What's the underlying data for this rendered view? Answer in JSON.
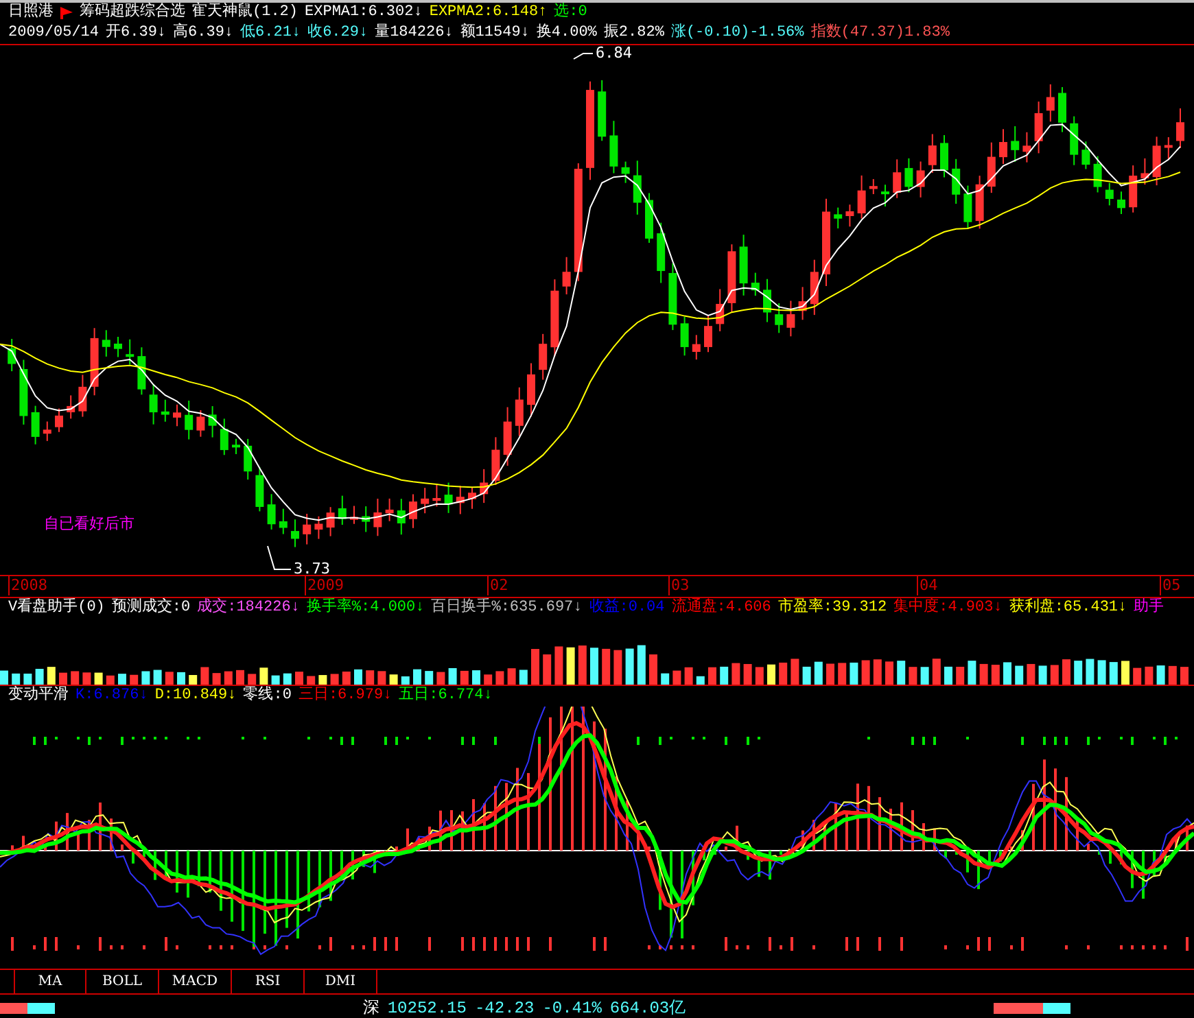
{
  "title_row": {
    "stock": "日照港",
    "formula": "筹码超跌综合选",
    "indicator": "寉天神鼠(1.2)",
    "values": [
      {
        "text": "EXPMA1:6.302↓",
        "color": "#ffffff"
      },
      {
        "text": "EXPMA2:6.148↑",
        "color": "#ffff00"
      },
      {
        "text": "选:0",
        "color": "#00ff00"
      }
    ]
  },
  "quote_row": [
    {
      "text": "2009/05/14",
      "color": "#ffffff"
    },
    {
      "text": "开6.39↓",
      "color": "#ffffff"
    },
    {
      "text": "高6.39↓",
      "color": "#ffffff"
    },
    {
      "text": "低6.21↓",
      "color": "#54fcfc"
    },
    {
      "text": "收6.29↓",
      "color": "#54fcfc"
    },
    {
      "text": "量184226↓",
      "color": "#ffffff"
    },
    {
      "text": "额11549↓",
      "color": "#ffffff"
    },
    {
      "text": "换4.00%",
      "color": "#ffffff"
    },
    {
      "text": "振2.82%",
      "color": "#ffffff"
    },
    {
      "text": "涨(-0.10)-1.56%",
      "color": "#54fcfc"
    },
    {
      "text": "指数(47.37)1.83%",
      "color": "#ff5454"
    }
  ],
  "price_chart": {
    "high_label": "6.84",
    "low_label": "3.73",
    "note": "自已看好后市"
  },
  "date_axis": [
    "2008",
    "2009",
    "02",
    "03",
    "04",
    "05"
  ],
  "volume_row": [
    {
      "text": "V看盘助手(0)",
      "color": "#ffffff"
    },
    {
      "text": "预测成交:0",
      "color": "#ffffff"
    },
    {
      "text": "成交:184226↓",
      "color": "#ff54ff"
    },
    {
      "text": "换手率%:4.000↓",
      "color": "#00ff00"
    },
    {
      "text": "百日换手%:635.697↓",
      "color": "#c0c0c0"
    },
    {
      "text": "收益:0.04",
      "color": "#0000ff"
    },
    {
      "text": "流通盘:4.606",
      "color": "#ff0000"
    },
    {
      "text": "市盈率:39.312",
      "color": "#ffff00"
    },
    {
      "text": "集中度:4.903↓",
      "color": "#ff0000"
    },
    {
      "text": "获利盘:65.431↓",
      "color": "#ffff00"
    },
    {
      "text": "助手",
      "color": "#ff00ff"
    }
  ],
  "indicator_row": [
    {
      "text": "变动平滑",
      "color": "#ffffff"
    },
    {
      "text": "K:6.876↓",
      "color": "#0000ff"
    },
    {
      "text": "D:10.849↓",
      "color": "#ffff00"
    },
    {
      "text": "零线:0",
      "color": "#ffffff"
    },
    {
      "text": "三日:6.979↓",
      "color": "#ff0000"
    },
    {
      "text": "五日:6.774↓",
      "color": "#00ff00"
    }
  ],
  "tabs": [
    {
      "label": "MA",
      "selected": false
    },
    {
      "label": "BOLL",
      "selected": false
    },
    {
      "label": "MACD",
      "selected": false
    },
    {
      "label": "RSI",
      "selected": false
    },
    {
      "label": "DMI",
      "selected": false
    }
  ],
  "status_bar": {
    "market": "深",
    "index": "10252.15",
    "change": "-42.23",
    "percent": "-0.41%",
    "amount": "664.03亿"
  }
}
